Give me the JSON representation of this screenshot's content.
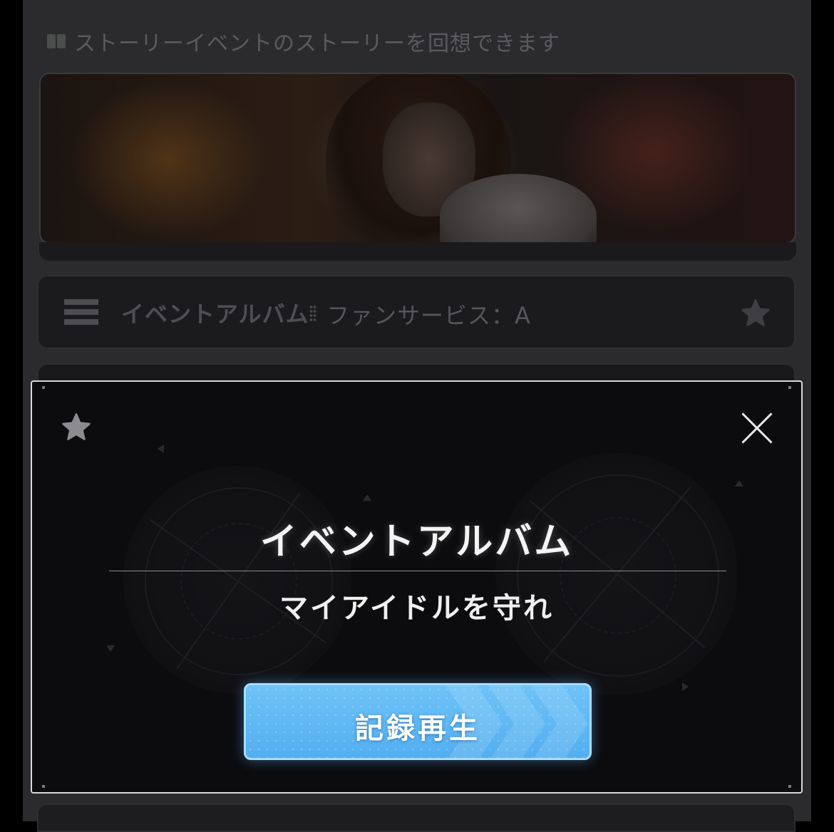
{
  "header": {
    "description": "ストーリーイベントのストーリーを回想できます",
    "icon": "book-icon"
  },
  "album_row": {
    "label": "イベントアルバム",
    "subtitle": "ファンサービス：A",
    "icons": [
      "list-icon",
      "star-icon"
    ]
  },
  "modal": {
    "title": "イベントアルバム",
    "subtitle": "マイアイドルを守れ",
    "play_button_label": "記録再生",
    "icons": [
      "star-icon",
      "close-icon"
    ]
  },
  "colors": {
    "panel_bg": "#2b2b2e",
    "modal_bg": "#0c0c0e",
    "modal_border": "#d9d9d9",
    "button_blue": "#5ab4f2",
    "button_border": "#a8dcff"
  }
}
